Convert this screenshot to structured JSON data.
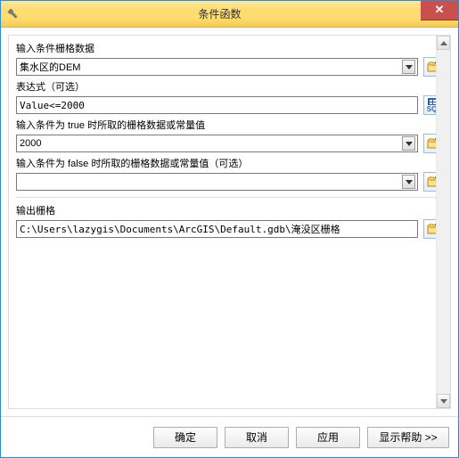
{
  "window": {
    "title": "条件函数"
  },
  "fields": {
    "input_raster": {
      "label": "输入条件栅格数据",
      "value": "集水区的DEM"
    },
    "expression": {
      "label": "表达式（可选）",
      "value": "Value<=2000"
    },
    "true_value": {
      "label": "输入条件为 true 时所取的栅格数据或常量值",
      "value": "2000"
    },
    "false_value": {
      "label": "输入条件为 false 时所取的栅格数据或常量值（可选）",
      "value": ""
    },
    "output_raster": {
      "label": "输出栅格",
      "value": "C:\\Users\\lazygis\\Documents\\ArcGIS\\Default.gdb\\淹没区栅格"
    }
  },
  "buttons": {
    "ok": "确定",
    "cancel": "取消",
    "apply": "应用",
    "help": "显示帮助 >>"
  },
  "icons": {
    "sql_label": "SQL"
  }
}
